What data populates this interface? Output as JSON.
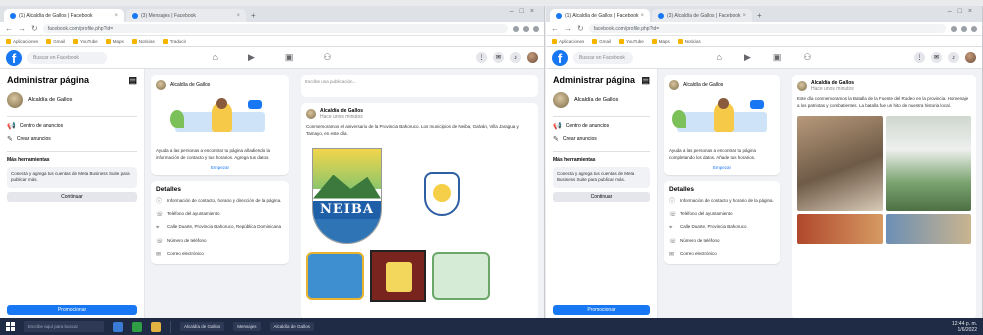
{
  "browser": {
    "left": {
      "tabs": [
        {
          "label": "(1) Alcaldía de Gallos | Facebook"
        },
        {
          "label": "(3) Mensajes | Facebook"
        }
      ],
      "url": "facebook.com/profile.php?id=",
      "bookmarks": [
        "Aplicaciones",
        "Gmail",
        "YouTube",
        "Maps",
        "Noticias",
        "Traducir"
      ]
    },
    "right": {
      "tabs": [
        {
          "label": "(1) Alcaldía de Gallos | Facebook"
        },
        {
          "label": "(3) Alcaldía de Gallos | Facebook"
        }
      ],
      "url": "facebook.com/profile.php?id=",
      "bookmarks": [
        "Aplicaciones",
        "Gmail",
        "YouTube",
        "Maps",
        "Noticias",
        "Traducir"
      ]
    }
  },
  "fb": {
    "search_placeholder": "Buscar en Facebook",
    "nav_icons": [
      "home-icon",
      "watch-icon",
      "marketplace-icon",
      "groups-icon"
    ],
    "brand_color": "#1877f2"
  },
  "left": {
    "sidebar": {
      "title": "Administrar página",
      "page_name": "Alcaldía de Gallos",
      "items": [
        "Centro de anuncios",
        "Crear anuncios"
      ],
      "tools_title": "Más herramientas",
      "tools_box": "Conecta y agrega tus cuentas de Meta Business Suite para publicar más.",
      "tools_button": "Continuar",
      "promote_button": "Promocionar"
    },
    "about": {
      "page_name": "Alcaldía de Gallos",
      "intro": "Ayuda a las personas a encontrar tu página añadiendo la información de contacto y tus horarios. Agrega tus datos.",
      "intro_link": "Empezar",
      "details_title": "Detalles",
      "details": [
        {
          "icon": "info-icon",
          "text": "Información de contacto, horario y dirección de la página."
        },
        {
          "icon": "phone-icon",
          "text": "Teléfono del ayuntamiento"
        },
        {
          "icon": "location-icon",
          "text": "Calle Duarte, Provincia Bahoruco, República Dominicana"
        },
        {
          "icon": "phone-icon",
          "text": "Número de teléfono"
        },
        {
          "icon": "mail-icon",
          "text": "Correo electrónico"
        }
      ]
    },
    "feed": {
      "composer_text": "Escribe una publicación...",
      "post_author": "Alcaldía de Gallos",
      "post_time": "Hace unos minutos",
      "post_text": "Conmemoramos el aniversario de la Provincia Bahoruco. Los municipios de Neiba, Galván, Villa Jaragua y Tamayo, en este día.",
      "neiba_label": "NEIBA"
    }
  },
  "right": {
    "sidebar": {
      "title": "Administrar página",
      "page_name": "Alcaldía de Gallos",
      "items": [
        "Centro de anuncios",
        "Crear anuncios"
      ],
      "tools_title": "Más herramientas",
      "tools_box": "Conecta y agrega tus cuentas de Meta Business Suite para publicar más.",
      "tools_button": "Continuar",
      "promote_button": "Promocionar"
    },
    "about": {
      "page_name": "Alcaldía de Gallos",
      "intro": "Ayuda a las personas a encontrar tu página completando los datos. Añade tus horarios.",
      "intro_link": "Empezar",
      "details_title": "Detalles",
      "details": [
        {
          "icon": "info-icon",
          "text": "Información de contacto y horario de la página."
        },
        {
          "icon": "phone-icon",
          "text": "Teléfono del ayuntamiento"
        },
        {
          "icon": "location-icon",
          "text": "Calle Duarte, Provincia Bahoruco"
        },
        {
          "icon": "phone-icon",
          "text": "Número de teléfono"
        },
        {
          "icon": "mail-icon",
          "text": "Correo electrónico"
        }
      ]
    },
    "feed": {
      "post_author": "Alcaldía de Gallos",
      "post_time": "Hace unos minutos",
      "post_text": "Este día conmemoramos la Batalla de la Fuente del Rodeo en la provincia. Homenaje a los patriotas y combatientes. La batalla fue un hito de nuestra historia local."
    }
  },
  "taskbar": {
    "search_placeholder": "Escribe aquí para buscar",
    "tasks": [
      "Alcaldía de Gallos",
      "Mensajes",
      "Alcaldía de Gallos"
    ],
    "clock_time": "12:44 p. m.",
    "clock_date": "1/6/2022"
  }
}
